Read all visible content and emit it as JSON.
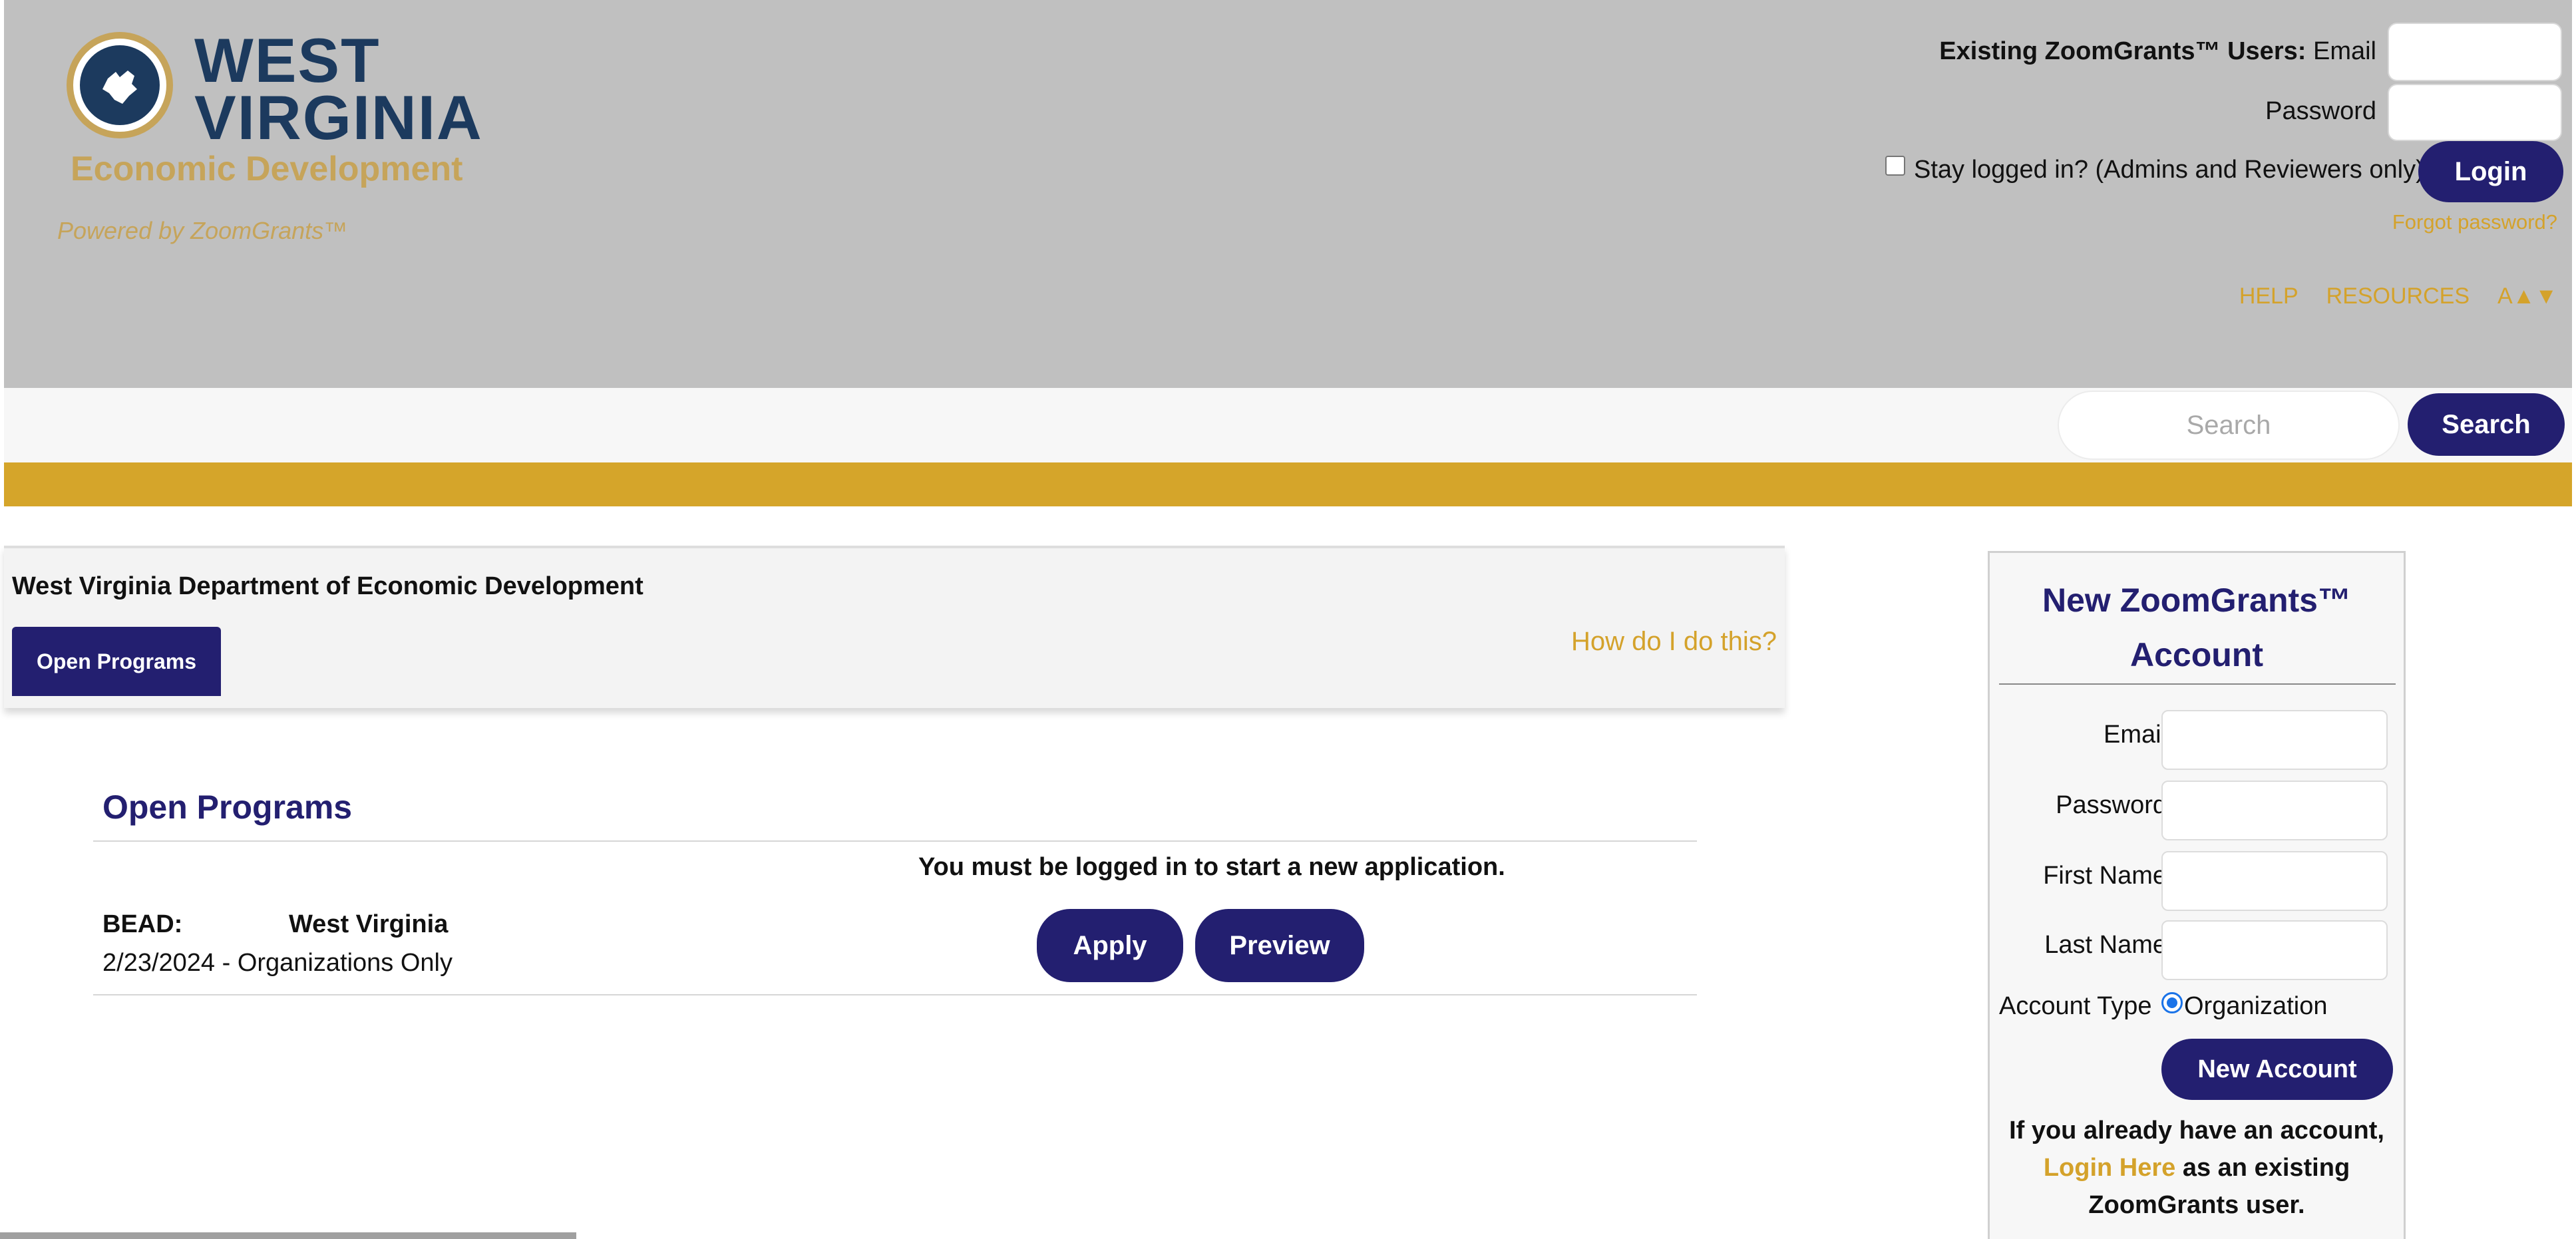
{
  "header": {
    "logo": {
      "line1": "WEST",
      "line2": "VIRGINIA",
      "line3": "Economic Development"
    },
    "powered_by": "Powered by ZoomGrants™",
    "existing_users_label": "Existing ZoomGrants™ Users:",
    "email_label": "Email",
    "password_label": "Password",
    "stay_logged_in": "Stay logged in? (Admins and Reviewers only)",
    "login_button": "Login",
    "forgot_password": "Forgot password?",
    "nav": {
      "help": "HELP",
      "resources": "RESOURCES",
      "text_size": "A▲▼"
    }
  },
  "search": {
    "placeholder": "Search",
    "button": "Search"
  },
  "org_panel": {
    "title": "West Virginia Department of Economic Development",
    "tab_open": "Open Programs",
    "help_link": "How do I do this?"
  },
  "programs": {
    "heading": "Open Programs",
    "notice": "You must be logged in to start a new application.",
    "items": [
      {
        "code": "BEAD:",
        "name": "West Virginia",
        "subtitle": "2/23/2024 - Organizations Only",
        "apply": "Apply",
        "preview": "Preview"
      }
    ]
  },
  "new_account": {
    "title": "New ZoomGrants™ Account",
    "email_label": "Email",
    "password_label": "Password",
    "first_name_label": "First Name",
    "last_name_label": "Last Name",
    "account_type_label": "Account Type",
    "account_type_option": "Organization",
    "button": "New Account",
    "already_prefix": "If you already have an account,",
    "login_here": "Login Here",
    "already_suffix": "as an existing ZoomGrants user."
  },
  "colors": {
    "navy": "#231f70",
    "gold": "#d5a52a",
    "header_gray": "#c0c0c0",
    "link_gold": "#d4a22b"
  }
}
